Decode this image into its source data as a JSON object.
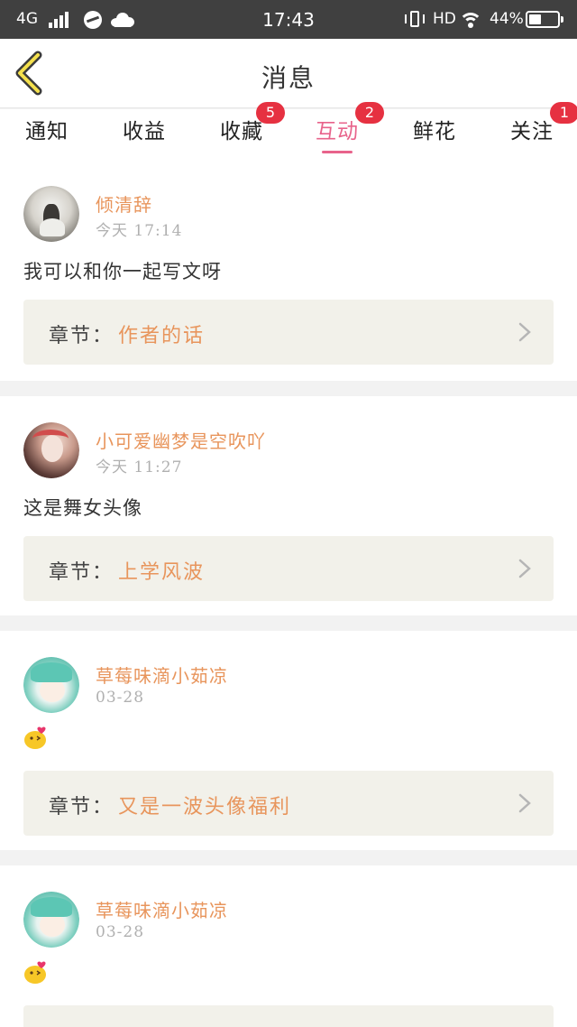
{
  "status_bar": {
    "network": "4G",
    "time": "17:43",
    "hd": "HD",
    "battery_percent": "44%",
    "battery_level": 0.44
  },
  "header": {
    "title": "消息"
  },
  "tabs": [
    {
      "label": "通知",
      "badge": ""
    },
    {
      "label": "收益",
      "badge": ""
    },
    {
      "label": "收藏",
      "badge": "5"
    },
    {
      "label": "互动",
      "badge": "2"
    },
    {
      "label": "鲜花",
      "badge": ""
    },
    {
      "label": "关注",
      "badge": "1"
    }
  ],
  "active_tab": "互动",
  "colors": {
    "accent": "#e8638b",
    "name": "#e8955c",
    "badge": "#e63141",
    "chapter_bg": "#f2f1ea"
  },
  "chapter_key": "章节：",
  "items": [
    {
      "name": "倾清辞",
      "time": "今天 17:14",
      "message": "我可以和你一起写文呀",
      "chapter": "作者的话",
      "avatar": "avatar-photo-girl",
      "emoji": ""
    },
    {
      "name": "小可爱幽梦是空吹吖",
      "time": "今天 11:27",
      "message": "这是舞女头像",
      "chapter": "上学风波",
      "avatar": "avatar-anime-girl",
      "emoji": ""
    },
    {
      "name": "草莓味滴小茹凉",
      "time": "03-28",
      "message": "",
      "chapter": "又是一波头像福利",
      "avatar": "avatar-green-hair",
      "emoji": "kiss-emoji"
    },
    {
      "name": "草莓味滴小茹凉",
      "time": "03-28",
      "message": "",
      "chapter": "",
      "avatar": "avatar-green-hair",
      "emoji": "kiss-emoji"
    }
  ]
}
